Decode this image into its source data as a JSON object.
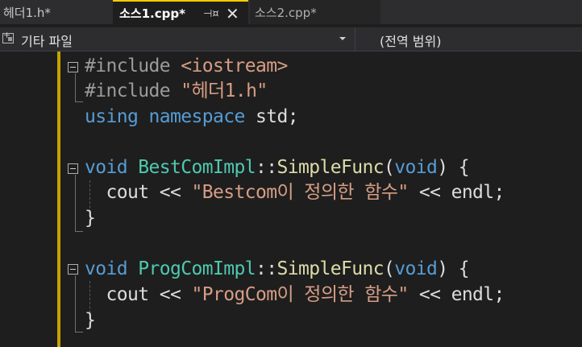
{
  "tabs": [
    {
      "label": "헤더1.h*",
      "active": false
    },
    {
      "label": "소스1.cpp*",
      "active": true
    },
    {
      "label": "소스2.cpp*",
      "active": false
    }
  ],
  "tab_icons": {
    "pin": "pin-icon",
    "close": "close-icon"
  },
  "navbar": {
    "scope": "기타 파일",
    "member": "(전역 범위)"
  },
  "code": {
    "l1": {
      "pp": "#include",
      "sp": " ",
      "path": "<iostream>"
    },
    "l2": {
      "pp": "#include",
      "sp": " ",
      "path": "\"헤더1.h\""
    },
    "l3": {
      "kw1": "using",
      "sp1": " ",
      "kw2": "namespace",
      "rest": " std;"
    },
    "l5": {
      "kw": "void",
      "sp": " ",
      "cls": "BestComImpl",
      "sep": "::",
      "fn": "SimpleFunc",
      "p1": "(",
      "kw2": "void",
      "p2": ") {"
    },
    "l6": {
      "indent": "  ",
      "a": "cout << ",
      "str": "\"Bestcom이 정의한 함수\"",
      "b": " << endl;"
    },
    "l7": {
      "brace": "}"
    },
    "l9": {
      "kw": "void",
      "sp": " ",
      "cls": "ProgComImpl",
      "sep": "::",
      "fn": "SimpleFunc",
      "p1": "(",
      "kw2": "void",
      "p2": ") {"
    },
    "l10": {
      "indent": "  ",
      "a": "cout << ",
      "str": "\"ProgCom이 정의한 함수\"",
      "b": " << endl;"
    },
    "l11": {
      "brace": "}"
    }
  },
  "colors": {
    "keyword": "#569cd6",
    "string": "#d69d85",
    "type": "#4ec9b0",
    "function": "#dcdcaa",
    "change_bar": "#c5a200"
  }
}
